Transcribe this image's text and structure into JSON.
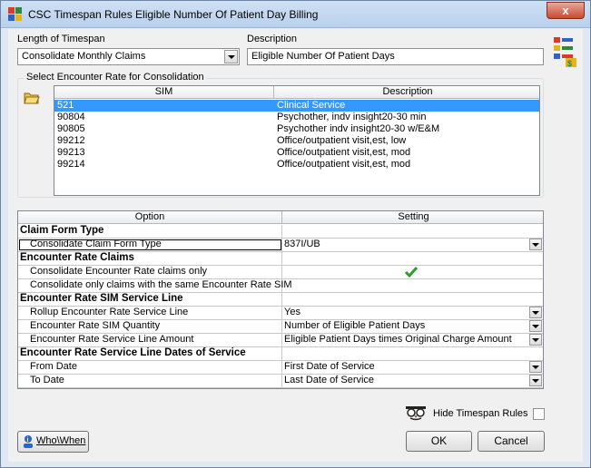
{
  "window": {
    "title": "CSC Timespan Rules  Eligible Number Of Patient Day Billing",
    "close_label": "x"
  },
  "top": {
    "length_label": "Length of Timespan",
    "length_value": "Consolidate Monthly Claims",
    "description_label": "Description",
    "description_value": "Eligible Number Of Patient Days"
  },
  "encounter": {
    "group_label": "Select Encounter Rate for Consolidation",
    "headers": [
      "SIM",
      "Description"
    ],
    "rows": [
      {
        "sim": "521",
        "desc": "Clinical Service",
        "selected": true
      },
      {
        "sim": "90804",
        "desc": "Psychother, indv insight20-30 min"
      },
      {
        "sim": "90805",
        "desc": "Psychother indv insight20-30 w/E&M"
      },
      {
        "sim": "99212",
        "desc": "Office/outpatient visit,est, low"
      },
      {
        "sim": "99213",
        "desc": "Office/outpatient visit,est, mod"
      },
      {
        "sim": "99214",
        "desc": "Office/outpatient visit,est, mod"
      }
    ]
  },
  "options": {
    "headers": [
      "Option",
      "Setting"
    ],
    "rows": [
      {
        "type": "section",
        "label": "Claim Form Type"
      },
      {
        "type": "child",
        "label": "Consolidate Claim Form Type",
        "setting": "837I/UB",
        "dropdown": true,
        "focused": true
      },
      {
        "type": "section",
        "label": "Encounter Rate Claims"
      },
      {
        "type": "child",
        "label": "Consolidate Encounter Rate claims  only",
        "check": true
      },
      {
        "type": "child",
        "label": "Consolidate only claims with the same Encounter Rate SIM"
      },
      {
        "type": "section",
        "label": "Encounter Rate SIM Service Line"
      },
      {
        "type": "child",
        "label": "Rollup Encounter Rate Service Line",
        "setting": "Yes",
        "dropdown": true
      },
      {
        "type": "child",
        "label": "Encounter Rate SIM Quantity",
        "setting": "Number of Eligible Patient Days",
        "dropdown": true
      },
      {
        "type": "child",
        "label": "Encounter Rate Service Line Amount",
        "setting": "Eligible Patient Days times Original Charge Amount",
        "dropdown": true
      },
      {
        "type": "section",
        "label": "Encounter Rate Service Line Dates of Service"
      },
      {
        "type": "child",
        "label": "From Date",
        "setting": "First Date of Service",
        "dropdown": true
      },
      {
        "type": "child",
        "label": "To Date",
        "setting": "Last Date of Service",
        "dropdown": true
      }
    ]
  },
  "footer": {
    "hide_label": "Hide Timespan Rules",
    "whowhen_label": "Who\\When",
    "ok_label": "OK",
    "cancel_label": "Cancel"
  },
  "colors": {
    "selection": "#3399ff",
    "check": "#2e9c2e",
    "close": "#c74a32"
  }
}
